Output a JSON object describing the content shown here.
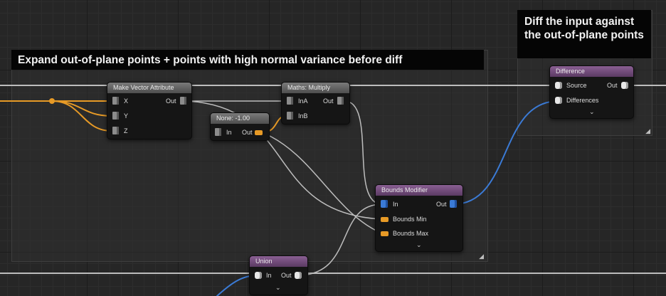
{
  "comments": {
    "expand": {
      "title": "Expand out-of-plane points + points with high normal variance before diff"
    },
    "diff": {
      "title": "Diff the input against the out-of-plane points"
    }
  },
  "nodes": {
    "make_vector": {
      "title": "Make Vector Attribute",
      "inputs": [
        "X",
        "Y",
        "Z"
      ],
      "output": "Out"
    },
    "none_const": {
      "title": "None: -1.00",
      "input": "In",
      "output": "Out"
    },
    "multiply": {
      "title": "Maths: Multiply",
      "inputs": [
        "InA",
        "InB"
      ],
      "output": "Out"
    },
    "bounds_modifier": {
      "title": "Bounds Modifier",
      "inputs": [
        "In",
        "Bounds Min",
        "Bounds Max"
      ],
      "output": "Out"
    },
    "difference": {
      "title": "Difference",
      "inputs": [
        "Source",
        "Differences"
      ],
      "output": "Out"
    },
    "union": {
      "title": "Union",
      "input": "In",
      "output": "Out"
    }
  },
  "colors": {
    "canvas_bg": "#262626",
    "wire_white": "#bdbdbd",
    "wire_orange": "#e79a26",
    "wire_blue": "#3b7bd6",
    "header_gray": "#6a6a6a",
    "header_purple": "#7a4f85"
  },
  "icons": [
    "expand-chevron-icon",
    "resize-grip-icon",
    "pin-icon"
  ]
}
